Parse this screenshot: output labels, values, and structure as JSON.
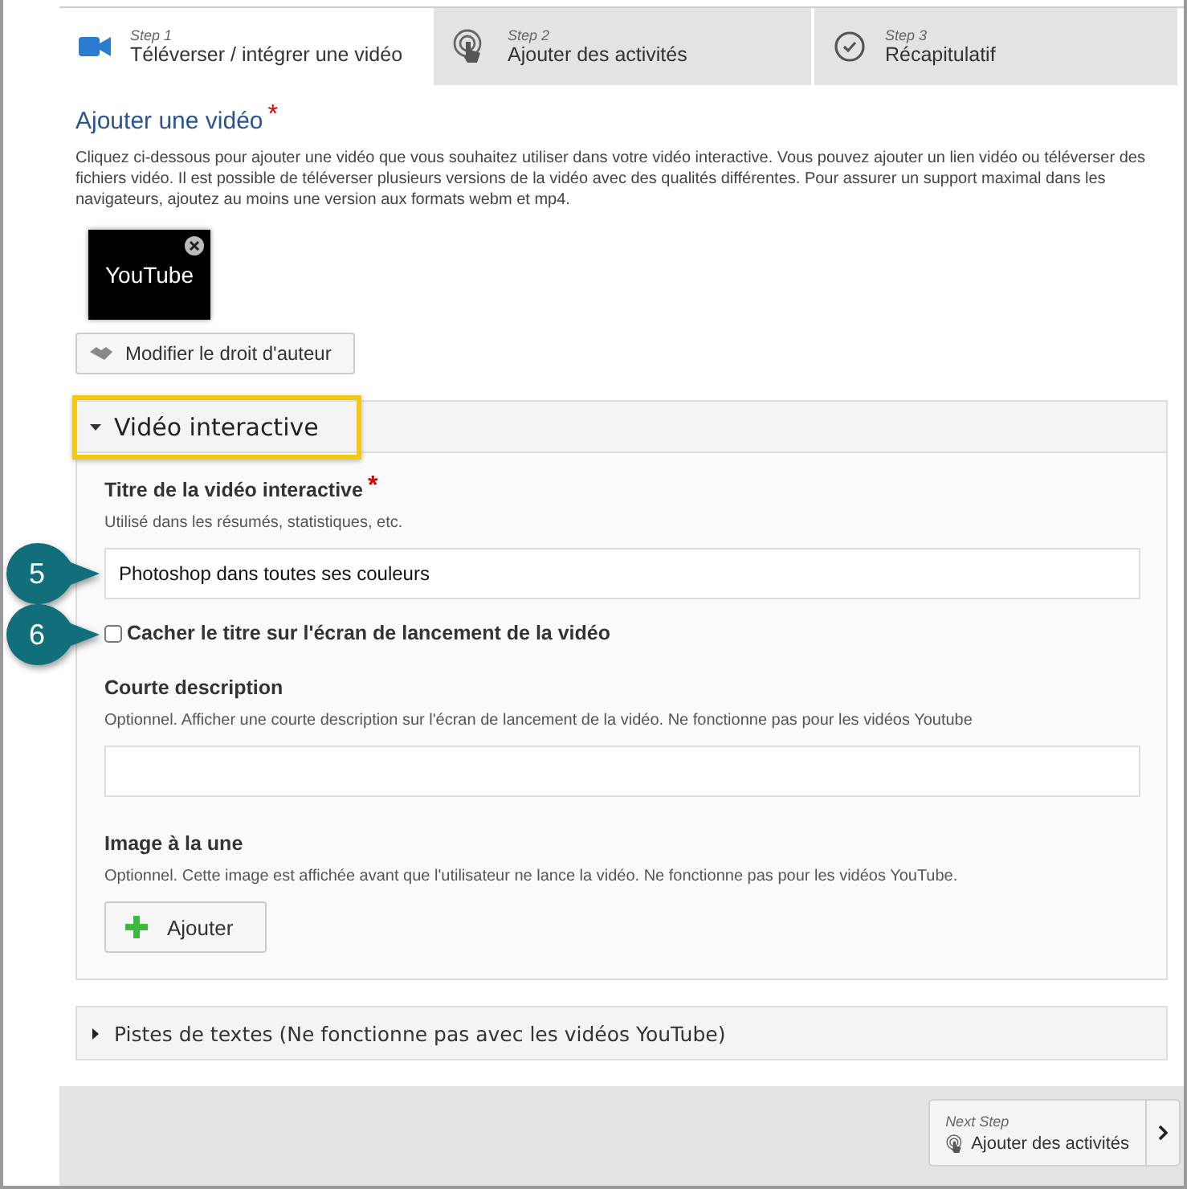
{
  "tabs": [
    {
      "step": "Step 1",
      "label": "Téléverser / intégrer une vidéo",
      "selected": true
    },
    {
      "step": "Step 2",
      "label": "Ajouter des activités",
      "selected": false
    },
    {
      "step": "Step 3",
      "label": "Récapitulatif",
      "selected": false
    }
  ],
  "video": {
    "heading": "Ajouter une vidéo",
    "required_mark": "*",
    "description": "Cliquez ci-dessous pour ajouter une vidéo que vous souhaitez utiliser dans votre vidéo interactive. Vous pouvez ajouter un lien vidéo ou téléverser des fichiers vidéo. Il est possible de téléverser plusieurs versions de la vidéo avec des qualités différentes. Pour assurer un support maximal dans les navigateurs, ajoutez au moins une version aux formats webm et mp4.",
    "thumbnail": "YouTube",
    "copyright_button": "Modifier le droit d'auteur"
  },
  "sections": [
    {
      "title": "Vidéo interactive",
      "expanded": true,
      "highlighted": true,
      "fields": [
        {
          "kind": "text",
          "label": "Titre de la vidéo interactive",
          "required_mark": "*",
          "hint": "Utilisé dans les résumés, statistiques, etc.",
          "value": "Photoshop dans toutes ses couleurs",
          "callout": "5"
        },
        {
          "kind": "checkbox",
          "label": "Cacher le titre sur l'écran de lancement de la vidéo",
          "checked": false,
          "callout": "6"
        },
        {
          "kind": "text",
          "label": "Courte description",
          "hint": "Optionnel. Afficher une courte description sur l'écran de lancement de la vidéo. Ne fonctionne pas pour les vidéos Youtube"
        },
        {
          "kind": "image",
          "label": "Image à la une",
          "hint": "Optionnel. Cette image est affichée avant que l'utilisateur ne lance la vidéo. Ne fonctionne pas pour les vidéos YouTube.",
          "button": "Ajouter"
        }
      ]
    },
    {
      "title": "Pistes de textes (Ne fonctionne pas avec les vidéos YouTube)",
      "expanded": false,
      "highlighted": false
    }
  ],
  "next_step": {
    "caption": "Next Step",
    "label": "Ajouter des activités"
  }
}
